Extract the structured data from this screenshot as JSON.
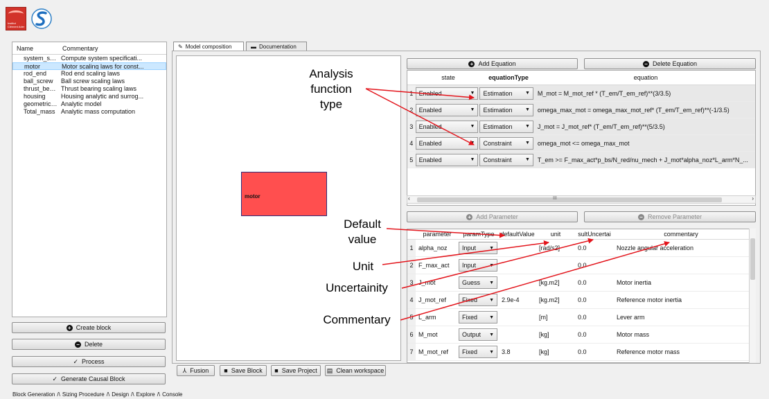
{
  "app": {
    "logo_text": "Institut Clément Ader"
  },
  "blocks": {
    "columns": [
      "Name",
      "Commentary"
    ],
    "rows": [
      {
        "name": "system_spe...",
        "comment": "Compute system specificati..."
      },
      {
        "name": "motor",
        "comment": "Motor scaling laws for const..."
      },
      {
        "name": "rod_end",
        "comment": "Rod end scaling laws"
      },
      {
        "name": "ball_screw",
        "comment": "Ball screw scaling laws"
      },
      {
        "name": "thrust_beari...",
        "comment": "Thrust bearing scaling laws"
      },
      {
        "name": "housing",
        "comment": "Housing analytic and surrog..."
      },
      {
        "name": "geometric_i...",
        "comment": "Analytic model"
      },
      {
        "name": "Total_mass",
        "comment": "Analytic mass computation"
      }
    ],
    "selected_index": 1
  },
  "left_buttons": {
    "create": "Create block",
    "delete": "Delete",
    "process": "Process",
    "generate": "Generate Causal Block"
  },
  "tabs": {
    "model": "Model composition",
    "docs": "Documentation"
  },
  "canvas": {
    "block_label": "motor",
    "block_color": "#ff4f4f"
  },
  "canvas_buttons": {
    "fusion": "Fusion",
    "save_block": "Save Block",
    "save_project": "Save Project",
    "clean": "Clean workspace"
  },
  "equations": {
    "add": "Add Equation",
    "delete": "Delete Equation",
    "headers": [
      "state",
      "equationType",
      "equation"
    ],
    "rows": [
      {
        "n": "1",
        "state": "Enabled",
        "type": "Estimation",
        "eq": "M_mot = M_mot_ref * (T_em/T_em_ref)**(3/3.5)"
      },
      {
        "n": "2",
        "state": "Enabled",
        "type": "Estimation",
        "eq": "omega_max_mot = omega_max_mot_ref* (T_em/T_em_ref)**(-1/3.5)"
      },
      {
        "n": "3",
        "state": "Enabled",
        "type": "Estimation",
        "eq": "J_mot = J_mot_ref* (T_em/T_em_ref)**(5/3.5)"
      },
      {
        "n": "4",
        "state": "Enabled",
        "type": "Constraint",
        "eq": "omega_mot <= omega_max_mot"
      },
      {
        "n": "5",
        "state": "Enabled",
        "type": "Constraint",
        "eq": "T_em >= F_max_act*p_bs/N_red/nu_mech + J_mot*alpha_noz*L_arm*N_..."
      }
    ],
    "scroll_mark": "III"
  },
  "parameters": {
    "add": "Add Parameter",
    "remove": "Remove Parameter",
    "headers": [
      "parameter",
      "paramType",
      "defaultValue",
      "unit",
      "sultUncertai",
      "commentary"
    ],
    "rows": [
      {
        "n": "1",
        "name": "alpha_noz",
        "type": "Input",
        "default": "",
        "unit": "[rad/s2]",
        "unc": "0.0",
        "comment": "Nozzle angular acceleration"
      },
      {
        "n": "2",
        "name": "F_max_act",
        "type": "Input",
        "default": "",
        "unit": "",
        "unc": "0.0",
        "comment": ""
      },
      {
        "n": "3",
        "name": "J_mot",
        "type": "Guess",
        "default": "",
        "unit": "[kg.m2]",
        "unc": "0.0",
        "comment": "Motor inertia"
      },
      {
        "n": "4",
        "name": "J_mot_ref",
        "type": "Fixed",
        "default": "2.9e-4",
        "unit": "[kg.m2]",
        "unc": "0.0",
        "comment": "Reference motor inertia"
      },
      {
        "n": "5",
        "name": "L_arm",
        "type": "Fixed",
        "default": "",
        "unit": "[m]",
        "unc": "0.0",
        "comment": "Lever arm"
      },
      {
        "n": "6",
        "name": "M_mot",
        "type": "Output",
        "default": "",
        "unit": "[kg]",
        "unc": "0.0",
        "comment": "Motor mass"
      },
      {
        "n": "7",
        "name": "M_mot_ref",
        "type": "Fixed",
        "default": "3.8",
        "unit": "[kg]",
        "unc": "0.0",
        "comment": "Reference motor mass"
      }
    ]
  },
  "annotations": {
    "analysis_type": [
      "Analysis",
      "function",
      "type"
    ],
    "default_value": [
      "Default",
      "value"
    ],
    "unit": "Unit",
    "uncertainty": "Uncertainity",
    "commentary": "Commentary",
    "arrow_color": "#e3141b"
  },
  "bottom_tabs": [
    "Block Generation",
    "Sizing Procedure",
    "Design",
    "Explore",
    "Console"
  ]
}
